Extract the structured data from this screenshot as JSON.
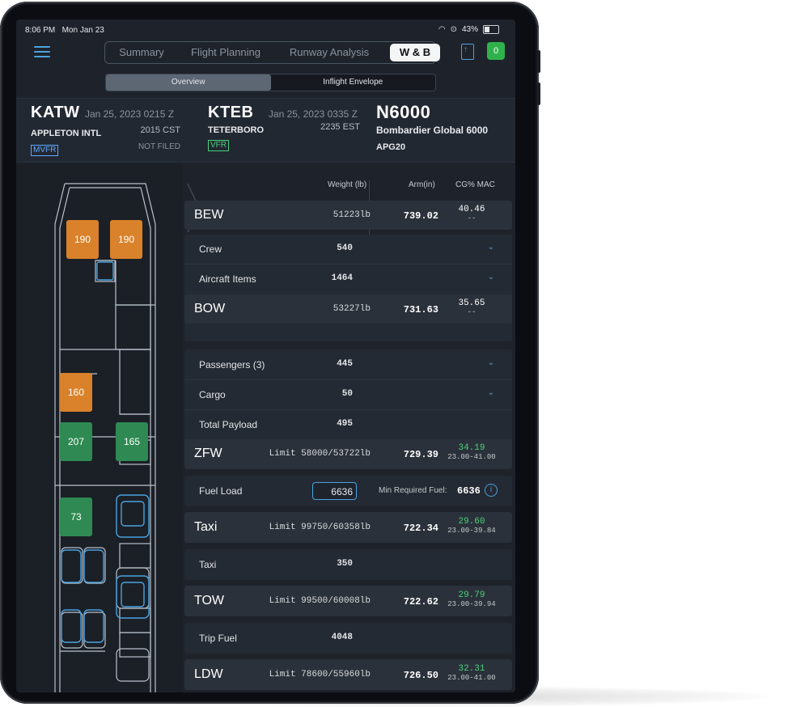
{
  "status": {
    "time": "8:06 PM",
    "date": "Mon Jan 23",
    "battery": "43%"
  },
  "tabs": [
    {
      "label": "Summary",
      "active": false
    },
    {
      "label": "Flight Planning",
      "active": false
    },
    {
      "label": "Runway Analysis",
      "active": false
    },
    {
      "label": "W & B",
      "active": true
    }
  ],
  "subtabs": [
    {
      "label": "Overview",
      "active": true
    },
    {
      "label": "Inflight Envelope",
      "active": false
    }
  ],
  "badge_count": "0",
  "origin": {
    "code": "KATW",
    "datetime": "Jan 25, 2023 0215 Z",
    "name": "APPLETON INTL",
    "local": "2015 CST",
    "flight_rules": "MVFR",
    "filed": "NOT FILED"
  },
  "destination": {
    "code": "KTEB",
    "datetime": "Jan 25, 2023 0335 Z",
    "name": "TETERBORO",
    "local": "2235 EST",
    "flight_rules": "VFR"
  },
  "aircraft": {
    "tail": "N6000",
    "model": "Bombardier Global 6000",
    "config": "APG20"
  },
  "seats": [
    {
      "value": "190",
      "color": "orange"
    },
    {
      "value": "190",
      "color": "orange"
    },
    {
      "value": "160",
      "color": "orange"
    },
    {
      "value": "207",
      "color": "green"
    },
    {
      "value": "165",
      "color": "green"
    },
    {
      "value": "73",
      "color": "green"
    }
  ],
  "columns": {
    "weight": "Weight (lb)",
    "arm": "Arm(in)",
    "cg": "CG% MAC"
  },
  "bew": {
    "label": "BEW",
    "weight": "51223lb",
    "arm": "739.02",
    "cg": "40.46",
    "range": "--"
  },
  "bow_items": [
    {
      "label": "Crew",
      "value": "540"
    },
    {
      "label": "Aircraft Items",
      "value": "1464"
    }
  ],
  "bow": {
    "label": "BOW",
    "weight": "53227lb",
    "arm": "731.63",
    "cg": "35.65",
    "range": "--"
  },
  "payload_items": [
    {
      "label": "Passengers (3)",
      "value": "445"
    },
    {
      "label": "Cargo",
      "value": "50"
    },
    {
      "label": "Total Payload",
      "value": "495"
    }
  ],
  "zfw": {
    "label": "ZFW",
    "limit": "Limit 58000/53722lb",
    "arm": "729.39",
    "cg": "34.19",
    "range": "23.00-41.00"
  },
  "fuel": {
    "label": "Fuel Load",
    "value": "6636",
    "min_label": "Min Required Fuel:",
    "min_value": "6636"
  },
  "taxi": {
    "label": "Taxi",
    "limit": "Limit 99750/60358lb",
    "arm": "722.34",
    "cg": "29.60",
    "range": "23.00-39.84"
  },
  "taxi_fuel": {
    "label": "Taxi",
    "value": "350"
  },
  "tow": {
    "label": "TOW",
    "limit": "Limit 99500/60008lb",
    "arm": "722.62",
    "cg": "29.79",
    "range": "23.00-39.94"
  },
  "trip_fuel": {
    "label": "Trip Fuel",
    "value": "4048"
  },
  "ldw": {
    "label": "LDW",
    "limit": "Limit 78600/55960lb",
    "arm": "726.50",
    "cg": "32.31",
    "range": "23.00-41.00"
  }
}
